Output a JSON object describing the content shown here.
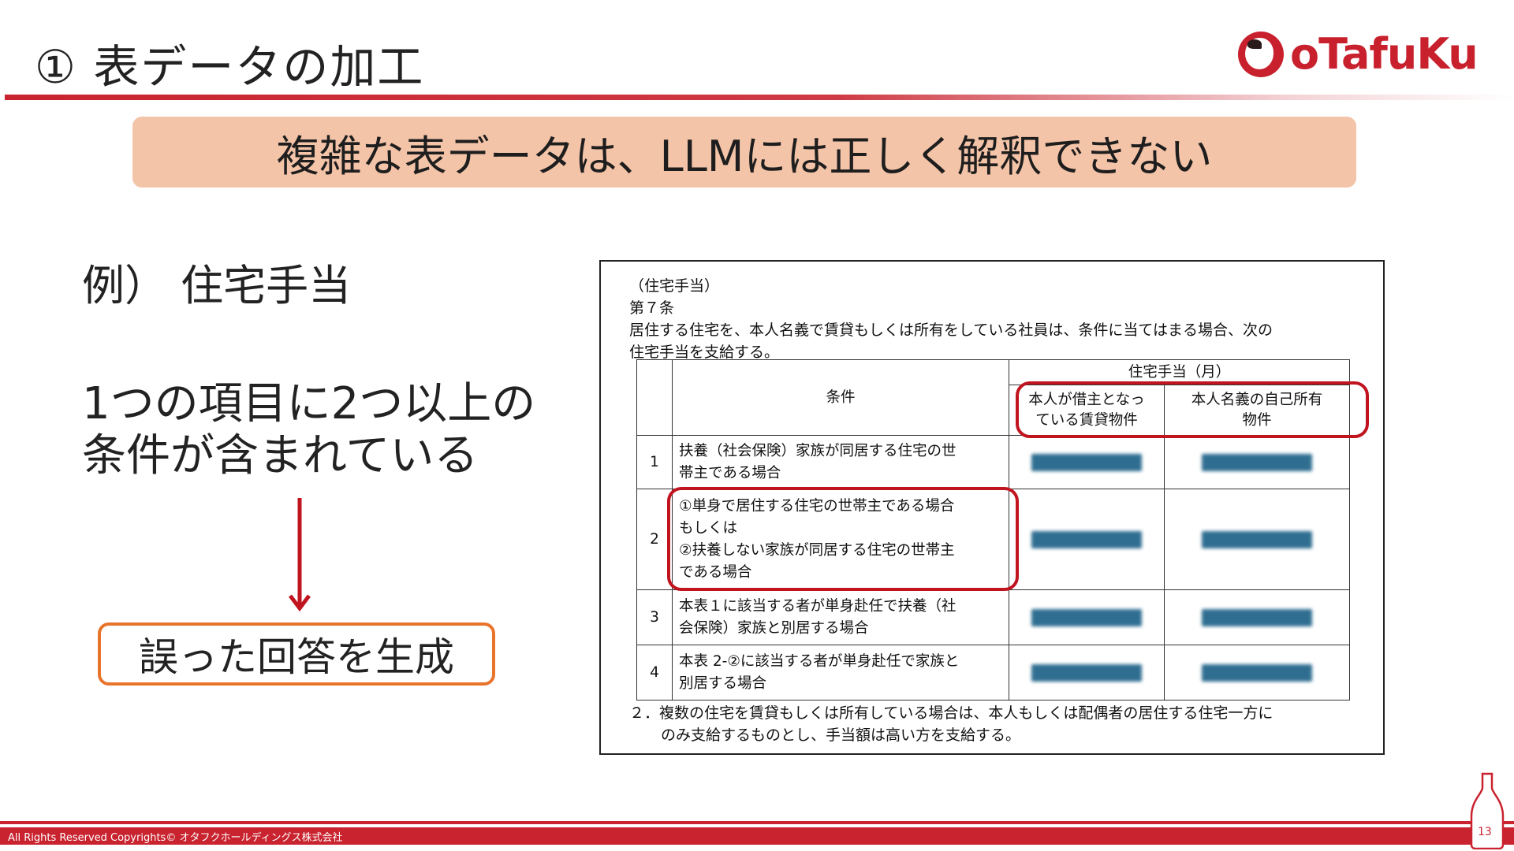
{
  "slide": {
    "title": "① 表データの加工",
    "banner": "複雑な表データは、LLMには正しく解釈できない",
    "example_label": "例） 住宅手当",
    "condition_line1": "1つの項目に2つ以上の",
    "condition_line2": "条件が含まれている",
    "result_label": "誤った回答を生成",
    "page_number": "13",
    "footer": "All Rights Reserved Copyrights© オタフクホールディングス株式会社"
  },
  "logo": {
    "text": "oTafuKu",
    "icon": "otafuku-face-icon"
  },
  "document": {
    "section_label": "（住宅手当）",
    "article": "第７条",
    "intro_line1": "居住する住宅を、本人名義で賃貸もしくは所有をしている社員は、条件に当てはまる場合、次の",
    "intro_line2": "住宅手当を支給する。",
    "table": {
      "header_condition": "条件",
      "header_group": "住宅手当（月）",
      "header_rental_line1": "本人が借主となっ",
      "header_rental_line2": "ている賃貸物件",
      "header_owned_line1": "本人名義の自己所有",
      "header_owned_line2": "物件",
      "rows": [
        {
          "no": "1",
          "line1": "扶養（社会保険）家族が同居する住宅の世",
          "line2": "帯主である場合"
        },
        {
          "no": "2",
          "line1": "①単身で居住する住宅の世帯主である場合",
          "line2": "もしくは",
          "line3": "②扶養しない家族が同居する住宅の世帯主",
          "line4": "である場合"
        },
        {
          "no": "3",
          "line1": "本表１に該当する者が単身赴任で扶養（社",
          "line2": "会保険）家族と別居する場合"
        },
        {
          "no": "4",
          "line1": "本表 2-②に該当する者が単身赴任で家族と",
          "line2": "別居する場合"
        }
      ]
    },
    "note_line1": "２．複数の住宅を賃貸もしくは所有している場合は、本人もしくは配偶者の居住する住宅一方に",
    "note_line2": "のみ支給するものとし、手当額は高い方を支給する。"
  },
  "colors": {
    "brand_red": "#c9232f",
    "banner_bg": "#f4c4a8",
    "result_border": "#e8742c",
    "highlight": "#c0141f",
    "redacted": "#1a5f86"
  }
}
